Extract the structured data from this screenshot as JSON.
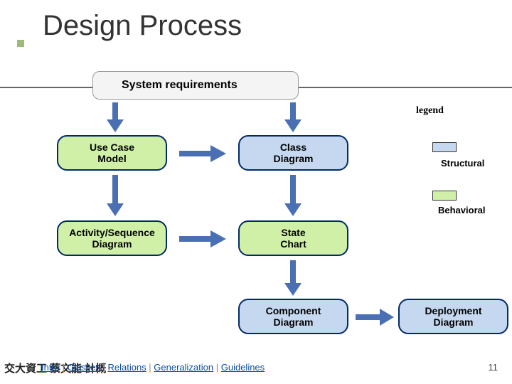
{
  "title": "Design Process",
  "sysreq": "System requirements",
  "legend_title": "legend",
  "legend": {
    "structural": "Structural",
    "behavioral": "Behavioral"
  },
  "nodes": {
    "usecase": "Use Case\nModel",
    "classd": "Class\nDiagram",
    "activity": "Activity/Sequence\nDiagram",
    "state": "State\nChart",
    "component": "Component\nDiagram",
    "deployment": "Deployment\nDiagram"
  },
  "breadcrumb": {
    "intro": "Intro",
    "classes": "Classes",
    "relations": "Relations",
    "generalization": "Generalization",
    "guidelines": "Guidelines",
    "sep": " | "
  },
  "footer_cjk": "交大資工 蔡文能 計概",
  "page_number": "11"
}
